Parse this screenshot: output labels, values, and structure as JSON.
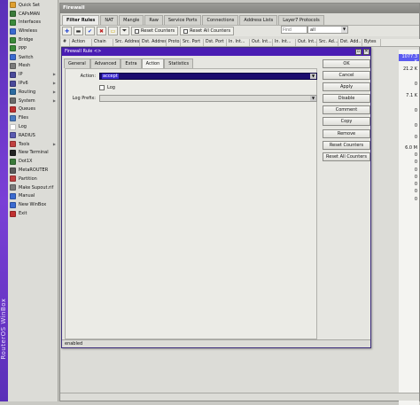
{
  "sidebar": {
    "brand": "RouterOS WinBox",
    "items": [
      {
        "label": "Quick Set",
        "icon": "quick-set-icon",
        "color": "#e0a030",
        "arrow": false
      },
      {
        "label": "CAPsMAN",
        "icon": "capsman-icon",
        "color": "#3a7a3a",
        "arrow": false
      },
      {
        "label": "Interfaces",
        "icon": "interfaces-icon",
        "color": "#3a8a3a",
        "arrow": false
      },
      {
        "label": "Wireless",
        "icon": "wireless-icon",
        "color": "#3a6ad0",
        "arrow": false
      },
      {
        "label": "Bridge",
        "icon": "bridge-icon",
        "color": "#3a8a3a",
        "arrow": false
      },
      {
        "label": "PPP",
        "icon": "ppp-icon",
        "color": "#3a8a3a",
        "arrow": false
      },
      {
        "label": "Switch",
        "icon": "switch-icon",
        "color": "#3a6ad0",
        "arrow": false
      },
      {
        "label": "Mesh",
        "icon": "mesh-icon",
        "color": "#7a7a7a",
        "arrow": false
      },
      {
        "label": "IP",
        "icon": "ip-icon",
        "color": "#4a4a9a",
        "arrow": true
      },
      {
        "label": "IPv6",
        "icon": "ipv6-icon",
        "color": "#4a4a9a",
        "arrow": true
      },
      {
        "label": "Routing",
        "icon": "routing-icon",
        "color": "#2a6aa0",
        "arrow": true
      },
      {
        "label": "System",
        "icon": "system-icon",
        "color": "#6a6a6a",
        "arrow": true
      },
      {
        "label": "Queues",
        "icon": "queues-icon",
        "color": "#c03030",
        "arrow": false
      },
      {
        "label": "Files",
        "icon": "files-icon",
        "color": "#4a7ac0",
        "arrow": false
      },
      {
        "label": "Log",
        "icon": "log-icon",
        "color": "#ffffff",
        "arrow": false
      },
      {
        "label": "RADIUS",
        "icon": "radius-icon",
        "color": "#5a5ab0",
        "arrow": false
      },
      {
        "label": "Tools",
        "icon": "tools-icon",
        "color": "#c04040",
        "arrow": true
      },
      {
        "label": "New Terminal",
        "icon": "terminal-icon",
        "color": "#222222",
        "arrow": false
      },
      {
        "label": "Dot1X",
        "icon": "dot1x-icon",
        "color": "#3a7a3a",
        "arrow": false
      },
      {
        "label": "MetaROUTER",
        "icon": "metarouter-icon",
        "color": "#5a5a5a",
        "arrow": false
      },
      {
        "label": "Partition",
        "icon": "partition-icon",
        "color": "#c04040",
        "arrow": false
      },
      {
        "label": "Make Supout.rif",
        "icon": "supout-icon",
        "color": "#7a7a7a",
        "arrow": false
      },
      {
        "label": "Manual",
        "icon": "manual-icon",
        "color": "#3a6ad0",
        "arrow": false
      },
      {
        "label": "New WinBox",
        "icon": "winbox-icon",
        "color": "#3a6ad0",
        "arrow": false
      },
      {
        "label": "Exit",
        "icon": "exit-icon",
        "color": "#c03030",
        "arrow": false
      }
    ]
  },
  "firewall": {
    "title": "Firewall",
    "tabs": [
      "Filter Rules",
      "NAT",
      "Mangle",
      "Raw",
      "Service Ports",
      "Connections",
      "Address Lists",
      "Layer7 Protocols"
    ],
    "active_tab": 0,
    "toolbar": {
      "reset_counters": "Reset Counters",
      "reset_all_counters": "Reset All Counters"
    },
    "find_placeholder": "Find",
    "filter_value": "all",
    "columns": [
      "#",
      "Action",
      "Chain",
      "Src. Address",
      "Dst. Address",
      "Proto...",
      "Src. Port",
      "Dst. Port",
      "In. Int...",
      "Out. Int...",
      "In. Int...",
      "Out. Int...",
      "Src. Ad...",
      "Dst. Add...",
      "Bytes"
    ],
    "bytes": [
      {
        "value": "1077.3 K",
        "selected": true
      },
      {
        "value": "21.2 K",
        "selected": false
      },
      {
        "value": "0",
        "selected": false
      },
      {
        "value": "7.1 K",
        "selected": false
      },
      {
        "value": "0",
        "selected": false
      },
      {
        "value": "0",
        "selected": false
      },
      {
        "value": "0",
        "selected": false
      },
      {
        "value": "6.0 M",
        "selected": false
      },
      {
        "value": "0",
        "selected": false
      },
      {
        "value": "0",
        "selected": false
      },
      {
        "value": "0",
        "selected": false
      },
      {
        "value": "0",
        "selected": false
      },
      {
        "value": "0",
        "selected": false
      },
      {
        "value": "0",
        "selected": false
      },
      {
        "value": "0",
        "selected": false
      }
    ]
  },
  "rule_dialog": {
    "title": "Firewall Rule <>",
    "tabs": [
      "General",
      "Advanced",
      "Extra",
      "Action",
      "Statistics"
    ],
    "active_tab": 3,
    "action_label": "Action:",
    "action_value": "accept",
    "log_label": "Log",
    "log_checked": false,
    "log_prefix_label": "Log Prefix:",
    "log_prefix_value": "",
    "buttons": {
      "ok": "OK",
      "cancel": "Cancel",
      "apply": "Apply",
      "disable": "Disable",
      "comment": "Comment",
      "copy": "Copy",
      "remove": "Remove",
      "reset_counters": "Reset Counters",
      "reset_all_counters": "Reset All Counters"
    },
    "status": "enabled"
  },
  "colors": {
    "dialog_title_bar": "#4a1db3",
    "action_field_bg": "#1c0d6e",
    "brand_strip": "#6a35c8",
    "selected_row": "#5a5af0"
  }
}
